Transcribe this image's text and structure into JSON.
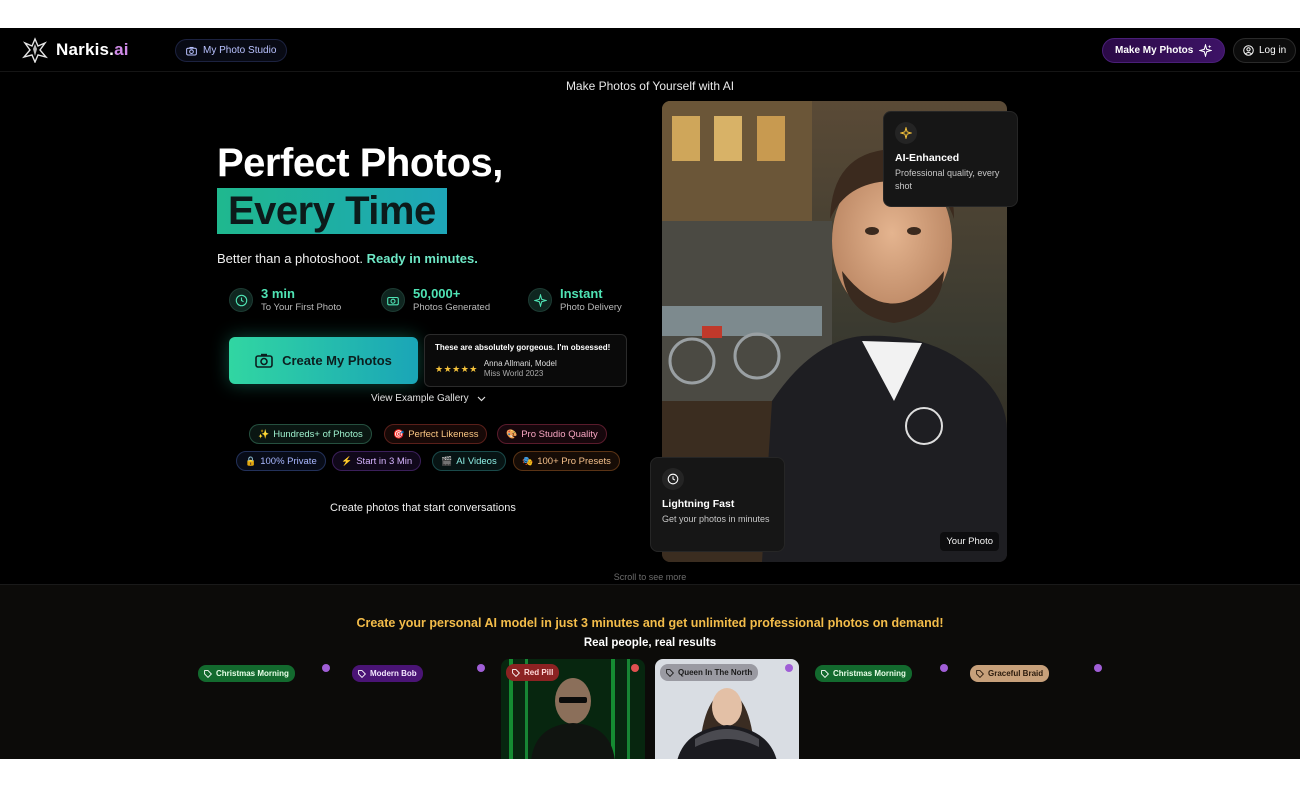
{
  "header": {
    "logo_prefix": "Narkis.",
    "logo_suffix": "ai",
    "studio_label": "My Photo Studio",
    "make_label": "Make My Photos",
    "login_label": "Log in"
  },
  "tagline": "Make Photos of Yourself with AI",
  "hero": {
    "title_line1": "Perfect Photos,",
    "title_line2": "Every Time",
    "subtitle_plain": "Better than a photoshoot.",
    "subtitle_accent": "Ready in minutes.",
    "stats": [
      {
        "value": "3 min",
        "label": "To Your First Photo",
        "icon": "clock-icon"
      },
      {
        "value": "50,000+",
        "label": "Photos Generated",
        "icon": "camera-icon"
      },
      {
        "value": "Instant",
        "label": "Photo Delivery",
        "icon": "sparkle-icon"
      }
    ],
    "cta_label": "Create My Photos",
    "testimonial": {
      "quote": "These are absolutely gorgeous. I'm obsessed!",
      "stars": "★★★★★",
      "name": "Anna Allmani, Model",
      "title": "Miss World 2023"
    },
    "gallery_link": "View Example Gallery",
    "chips": [
      {
        "emoji": "✨",
        "label": "Hundreds+ of Photos"
      },
      {
        "emoji": "🎯",
        "label": "Perfect Likeness"
      },
      {
        "emoji": "🎨",
        "label": "Pro Studio Quality"
      },
      {
        "emoji": "🔒",
        "label": "100% Private"
      },
      {
        "emoji": "⚡",
        "label": "Start in 3 Min"
      },
      {
        "emoji": "🎬",
        "label": "AI Videos"
      },
      {
        "emoji": "🎭",
        "label": "100+ Pro Presets"
      }
    ],
    "conversations": "Create photos that start conversations"
  },
  "photo": {
    "badge": "Your Photo",
    "card_enhanced": {
      "title": "AI-Enhanced",
      "desc": "Professional quality, every shot"
    },
    "card_fast": {
      "title": "Lightning Fast",
      "desc": "Get your photos in minutes"
    }
  },
  "scroll_hint": "Scroll to see more",
  "lower": {
    "promo": "Create your personal AI model in just 3 minutes and get unlimited professional photos on demand!",
    "real_results": "Real people, real results",
    "tags": [
      "Christmas Morning",
      "Modern Bob",
      "Red Pill",
      "Queen In The North",
      "Christmas Morning",
      "Graceful Braid"
    ]
  },
  "colors": {
    "accent_green": "#31d6a2",
    "accent_teal": "#1aa5b7",
    "promo_gold": "#f4bd4a",
    "logo_purple": "#d08be8"
  }
}
